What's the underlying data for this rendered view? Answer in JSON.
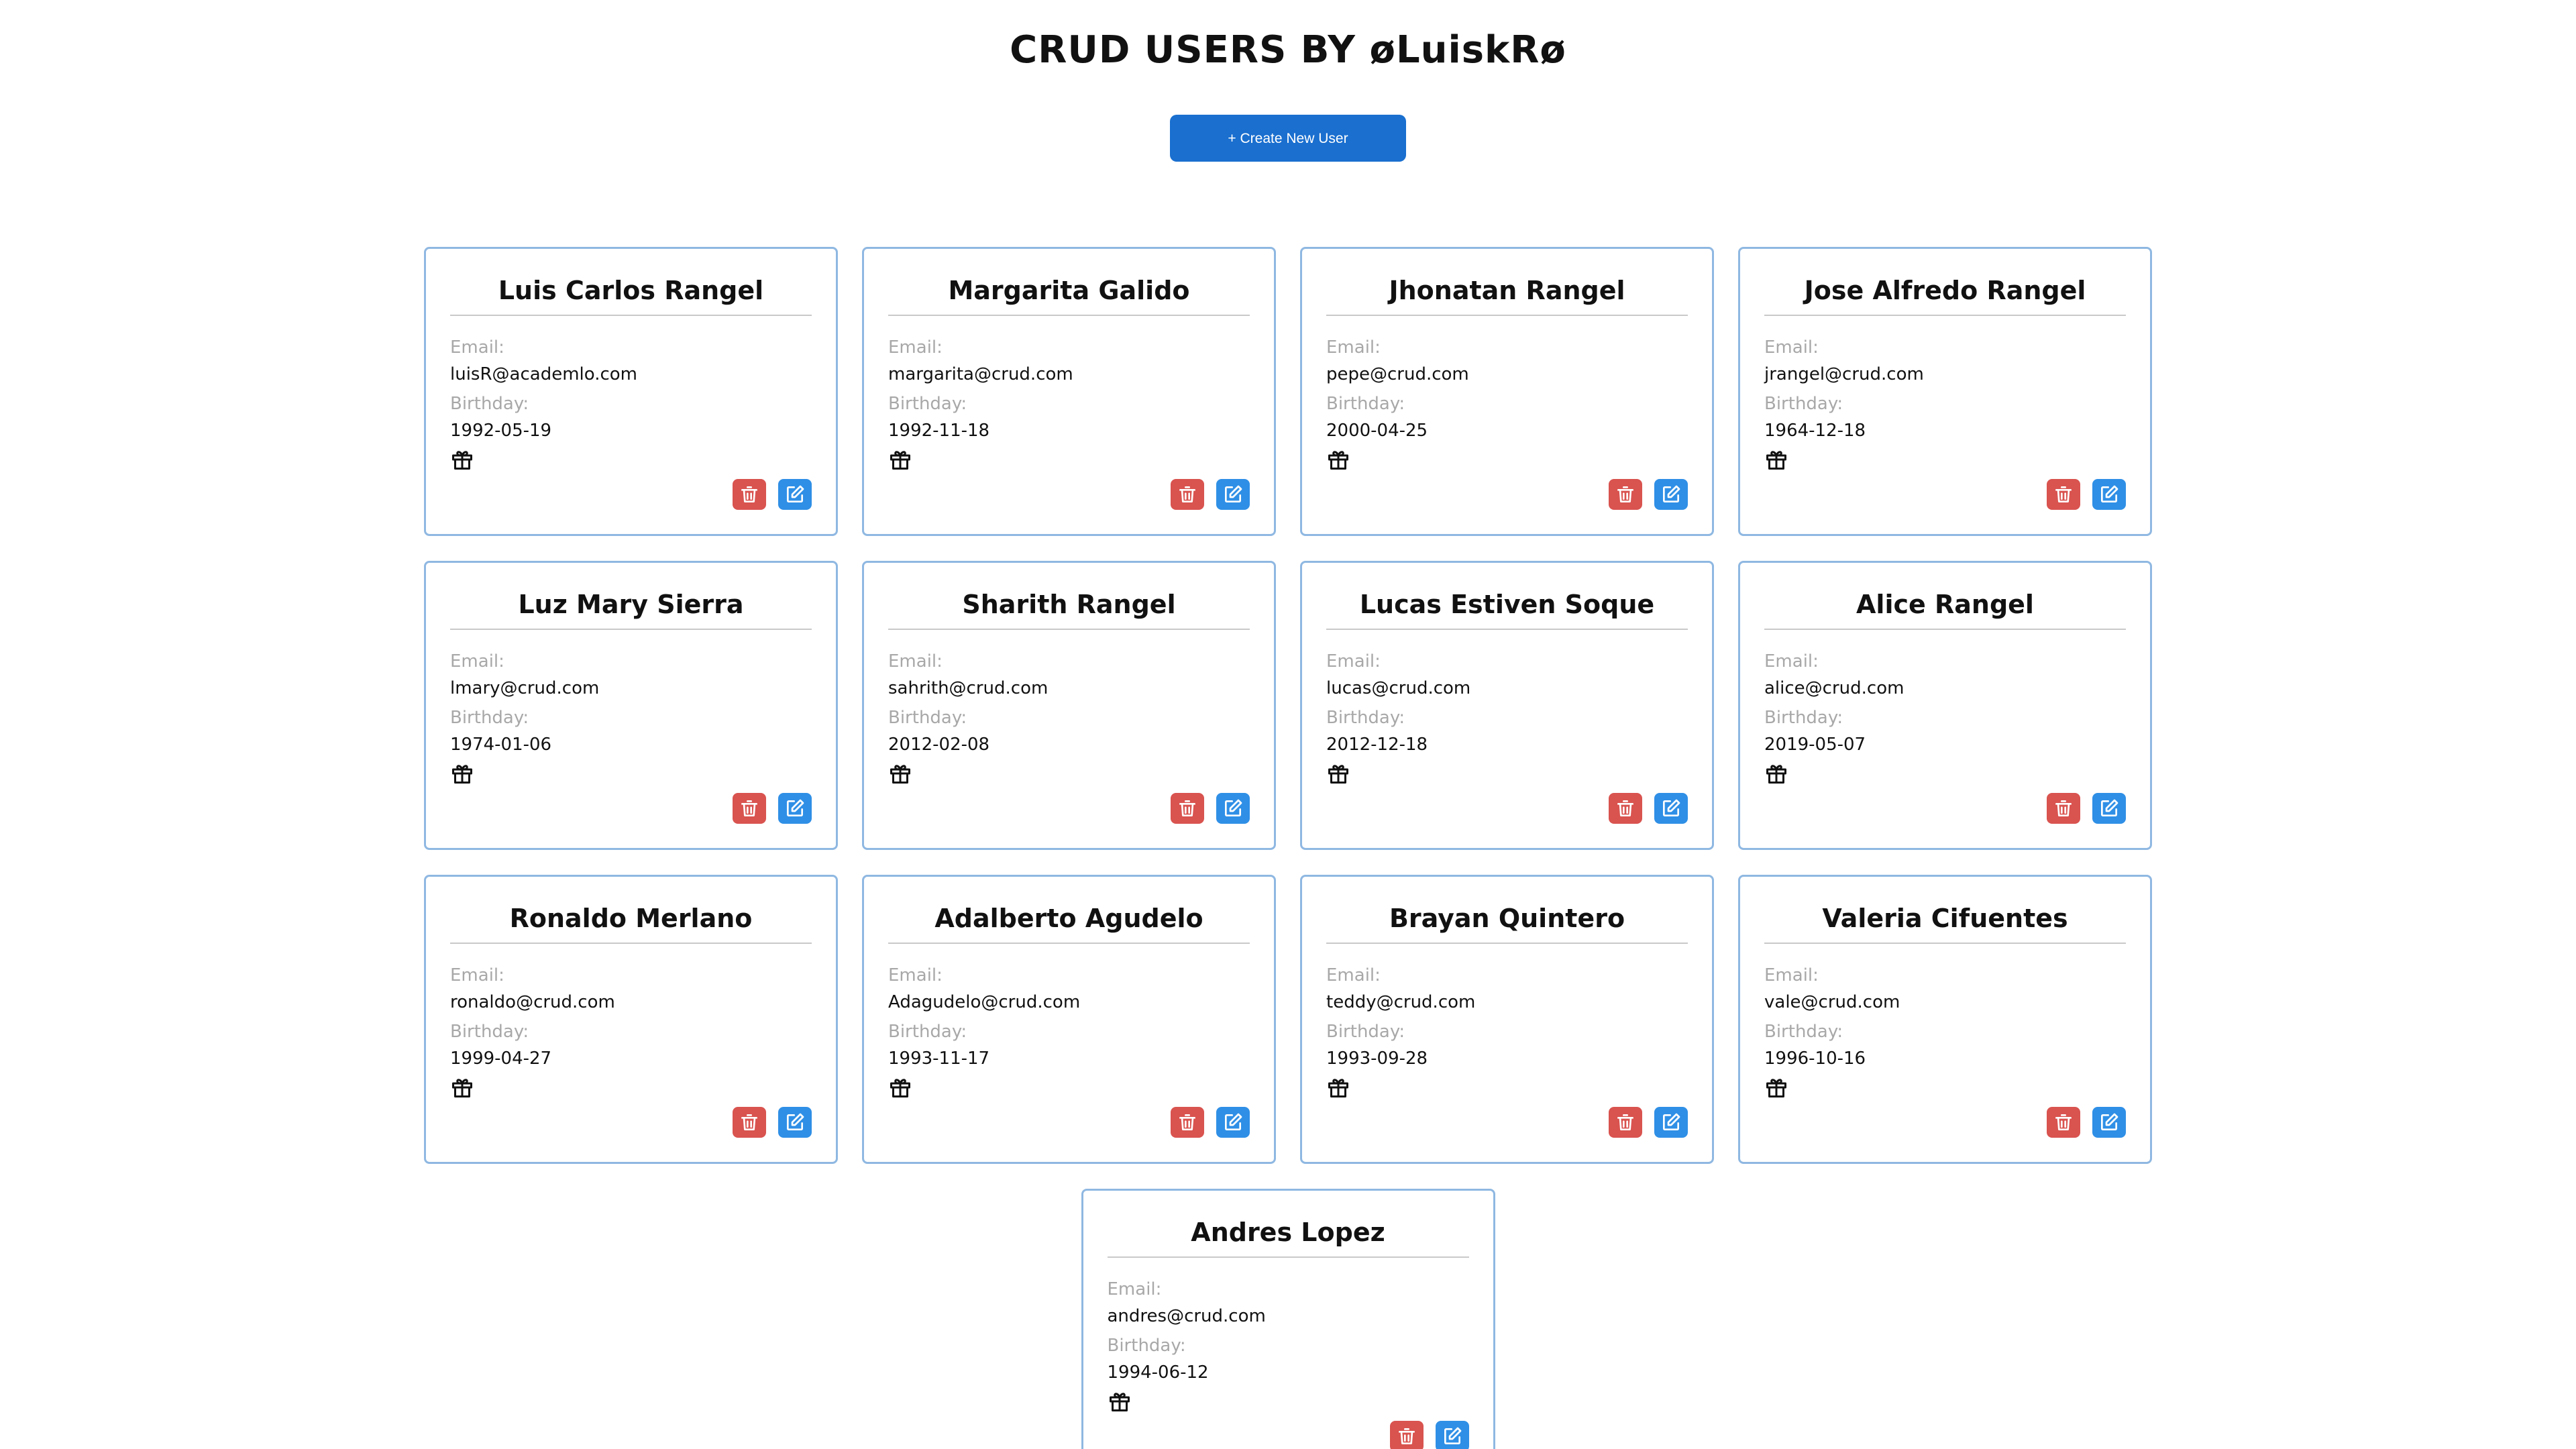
{
  "header": {
    "title": "CRUD USERS BY øLuiskRø",
    "create_label": "+ Create New User"
  },
  "labels": {
    "email": "Email:",
    "birthday": "Birthday:"
  },
  "icons": {
    "gift": "gift-icon",
    "delete": "trash-icon",
    "edit": "edit-icon"
  },
  "colors": {
    "primary": "#1a6fcf",
    "delete": "#d9534f",
    "edit": "#2f8fe6",
    "card_border": "#8fb8e2"
  },
  "users": [
    {
      "name": "Luis Carlos Rangel",
      "email": "luisR@academlo.com",
      "birthday": "1992-05-19"
    },
    {
      "name": "Margarita Galido",
      "email": "margarita@crud.com",
      "birthday": "1992-11-18"
    },
    {
      "name": "Jhonatan Rangel",
      "email": "pepe@crud.com",
      "birthday": "2000-04-25"
    },
    {
      "name": "Jose Alfredo Rangel",
      "email": "jrangel@crud.com",
      "birthday": "1964-12-18"
    },
    {
      "name": "Luz Mary Sierra",
      "email": "lmary@crud.com",
      "birthday": "1974-01-06"
    },
    {
      "name": "Sharith Rangel",
      "email": "sahrith@crud.com",
      "birthday": "2012-02-08"
    },
    {
      "name": "Lucas Estiven Soque",
      "email": "lucas@crud.com",
      "birthday": "2012-12-18"
    },
    {
      "name": "Alice Rangel",
      "email": "alice@crud.com",
      "birthday": "2019-05-07"
    },
    {
      "name": "Ronaldo Merlano",
      "email": "ronaldo@crud.com",
      "birthday": "1999-04-27"
    },
    {
      "name": "Adalberto Agudelo",
      "email": "Adagudelo@crud.com",
      "birthday": "1993-11-17"
    },
    {
      "name": "Brayan Quintero",
      "email": "teddy@crud.com",
      "birthday": "1993-09-28"
    },
    {
      "name": "Valeria Cifuentes",
      "email": "vale@crud.com",
      "birthday": "1996-10-16"
    },
    {
      "name": "Andres Lopez",
      "email": "andres@crud.com",
      "birthday": "1994-06-12"
    }
  ]
}
